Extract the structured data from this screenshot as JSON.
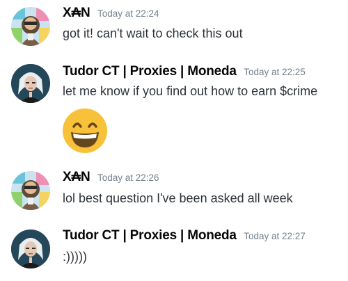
{
  "messages": [
    {
      "author": "X₳N",
      "timestamp": "Today at 22:24",
      "text": "got it! can't wait to check this out"
    },
    {
      "author": "Tudor CT | Proxies | Moneda",
      "timestamp": "Today at 22:25",
      "text": "let me know if you find out how to earn $crime",
      "attachment_emoji": "grinning-face-with-smiling-eyes"
    },
    {
      "author": "X₳N",
      "timestamp": "Today at 22:26",
      "text": "lol best question I've been asked all week"
    },
    {
      "author": "Tudor CT | Proxies | Moneda",
      "timestamp": "Today at 22:27",
      "text": ":)))))"
    }
  ],
  "colors": {
    "username": "#060607",
    "timestamp": "#747f8d",
    "text": "#2e3338",
    "emoji_face": "#f7c23a"
  }
}
